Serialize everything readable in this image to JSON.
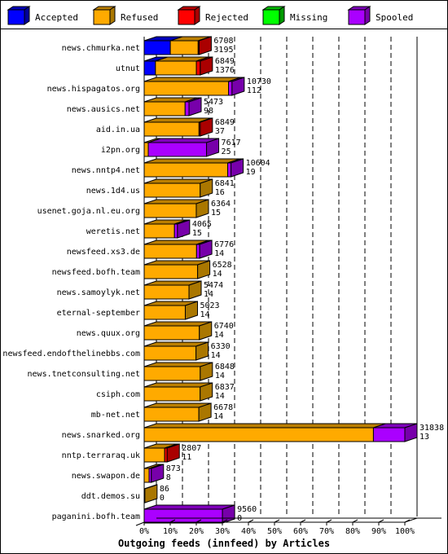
{
  "chart_data": {
    "type": "bar",
    "orientation": "horizontal",
    "stacked": true,
    "title": "Outgoing feeds (innfeed) by Articles",
    "xlabel": "Outgoing feeds (innfeed) by Articles",
    "ylabel": "",
    "xlim": [
      0,
      100
    ],
    "x_unit": "percent of maximum total",
    "x_ticks": [
      "0%",
      "10%",
      "20%",
      "30%",
      "40%",
      "50%",
      "60%",
      "70%",
      "80%",
      "90%",
      "100%"
    ],
    "grid": true,
    "legend_position": "top",
    "legend": [
      {
        "name": "Accepted",
        "color": "#0000ff",
        "side": "#000099",
        "top": "#0000bb"
      },
      {
        "name": "Refused",
        "color": "#ffaa00",
        "side": "#aa7700",
        "top": "#bb7f00"
      },
      {
        "name": "Rejected",
        "color": "#ff0000",
        "side": "#aa0000",
        "top": "#bb0000"
      },
      {
        "name": "Missing",
        "color": "#00ff00",
        "side": "#009900",
        "top": "#00bb00"
      },
      {
        "name": "Spooled",
        "color": "#aa00ff",
        "side": "#7700aa",
        "top": "#7f00bb"
      }
    ],
    "max_total": 31838,
    "categories": [
      "news.chmurka.net",
      "utnut",
      "news.hispagatos.org",
      "news.ausics.net",
      "aid.in.ua",
      "i2pn.org",
      "news.nntp4.net",
      "news.1d4.us",
      "usenet.goja.nl.eu.org",
      "weretis.net",
      "newsfeed.xs3.de",
      "newsfeed.bofh.team",
      "news.samoylyk.net",
      "eternal-september",
      "news.quux.org",
      "newsfeed.endofthelinebbs.com",
      "news.tnetconsulting.net",
      "csiph.com",
      "mb-net.net",
      "news.snarked.org",
      "nntp.terraraq.uk",
      "news.swapon.de",
      "ddt.demos.su",
      "paganini.bofh.team"
    ],
    "labels_top": [
      6708,
      6849,
      10730,
      5473,
      6849,
      7617,
      10604,
      6841,
      6364,
      4065,
      6776,
      6528,
      5474,
      5023,
      6740,
      6330,
      6848,
      6837,
      6678,
      31838,
      2807,
      873,
      86,
      9560
    ],
    "labels_bottom": [
      3195,
      1376,
      112,
      98,
      37,
      25,
      19,
      16,
      15,
      15,
      14,
      14,
      14,
      14,
      14,
      14,
      14,
      14,
      14,
      13,
      11,
      8,
      0,
      0
    ],
    "series": [
      {
        "name": "Accepted",
        "values": [
          3195,
          1376,
          0,
          0,
          0,
          0,
          0,
          0,
          0,
          0,
          0,
          0,
          0,
          0,
          0,
          0,
          0,
          0,
          0,
          0,
          0,
          0,
          0,
          0
        ]
      },
      {
        "name": "Refused",
        "values": [
          3400,
          5000,
          10300,
          5000,
          6700,
          500,
          10200,
          6841,
          6364,
          3700,
          6400,
          6528,
          5474,
          5023,
          6740,
          6330,
          6848,
          6837,
          6678,
          28000,
          2500,
          600,
          86,
          0
        ]
      },
      {
        "name": "Rejected",
        "values": [
          113,
          473,
          0,
          0,
          149,
          0,
          0,
          0,
          0,
          0,
          0,
          0,
          0,
          0,
          0,
          0,
          0,
          0,
          0,
          0,
          307,
          0,
          0,
          0
        ]
      },
      {
        "name": "Missing",
        "values": [
          0,
          0,
          0,
          0,
          0,
          0,
          0,
          0,
          0,
          0,
          0,
          0,
          0,
          0,
          0,
          0,
          0,
          0,
          0,
          0,
          0,
          0,
          0,
          0
        ]
      },
      {
        "name": "Spooled",
        "values": [
          0,
          0,
          430,
          473,
          0,
          7117,
          404,
          0,
          0,
          365,
          376,
          0,
          0,
          0,
          0,
          0,
          0,
          0,
          0,
          3838,
          0,
          273,
          0,
          9560
        ]
      }
    ]
  }
}
